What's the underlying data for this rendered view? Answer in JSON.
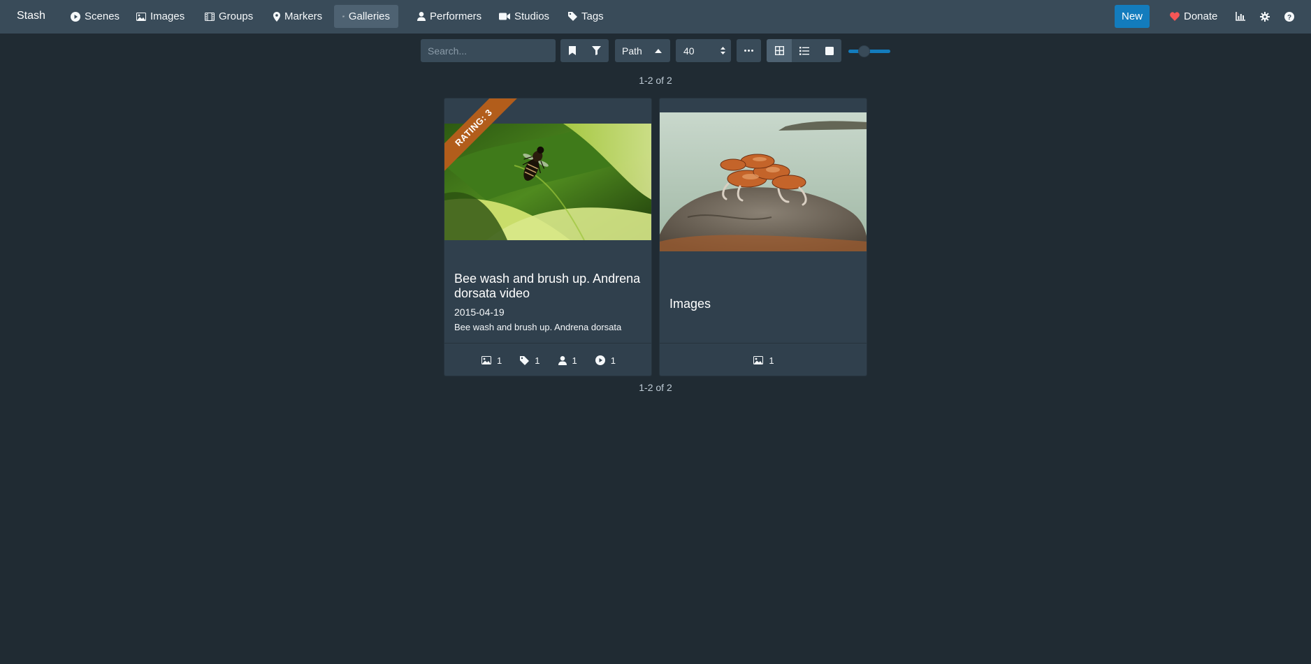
{
  "nav": {
    "brand": "Stash",
    "items": [
      {
        "label": "Scenes",
        "icon": "play-circle-icon"
      },
      {
        "label": "Images",
        "icon": "image-icon"
      },
      {
        "label": "Groups",
        "icon": "film-icon"
      },
      {
        "label": "Markers",
        "icon": "map-marker-icon"
      },
      {
        "label": "Galleries",
        "icon": "images-icon",
        "active": true
      },
      {
        "label": "Performers",
        "icon": "user-icon"
      },
      {
        "label": "Studios",
        "icon": "video-icon"
      },
      {
        "label": "Tags",
        "icon": "tag-icon"
      }
    ],
    "new_label": "New",
    "donate_label": "Donate",
    "donate_color": "#f55656",
    "accent_color": "#137cbd"
  },
  "toolbar": {
    "search_placeholder": "Search...",
    "sort_by": "Path",
    "sort_direction": "ascending",
    "per_page": "40",
    "display_mode": "grid",
    "zoom_level": 1
  },
  "results": {
    "count_text": "1-2 of 2"
  },
  "galleries": [
    {
      "title": "Bee wash and brush up. Andrena dorsata video",
      "date": "2015-04-19",
      "details": "Bee wash and brush up. Andrena dorsata",
      "rating_label": "RATING: 3",
      "image_count": "1",
      "tag_count": "1",
      "performer_count": "1",
      "scene_count": "1"
    },
    {
      "title": "Images",
      "image_count": "1"
    }
  ]
}
